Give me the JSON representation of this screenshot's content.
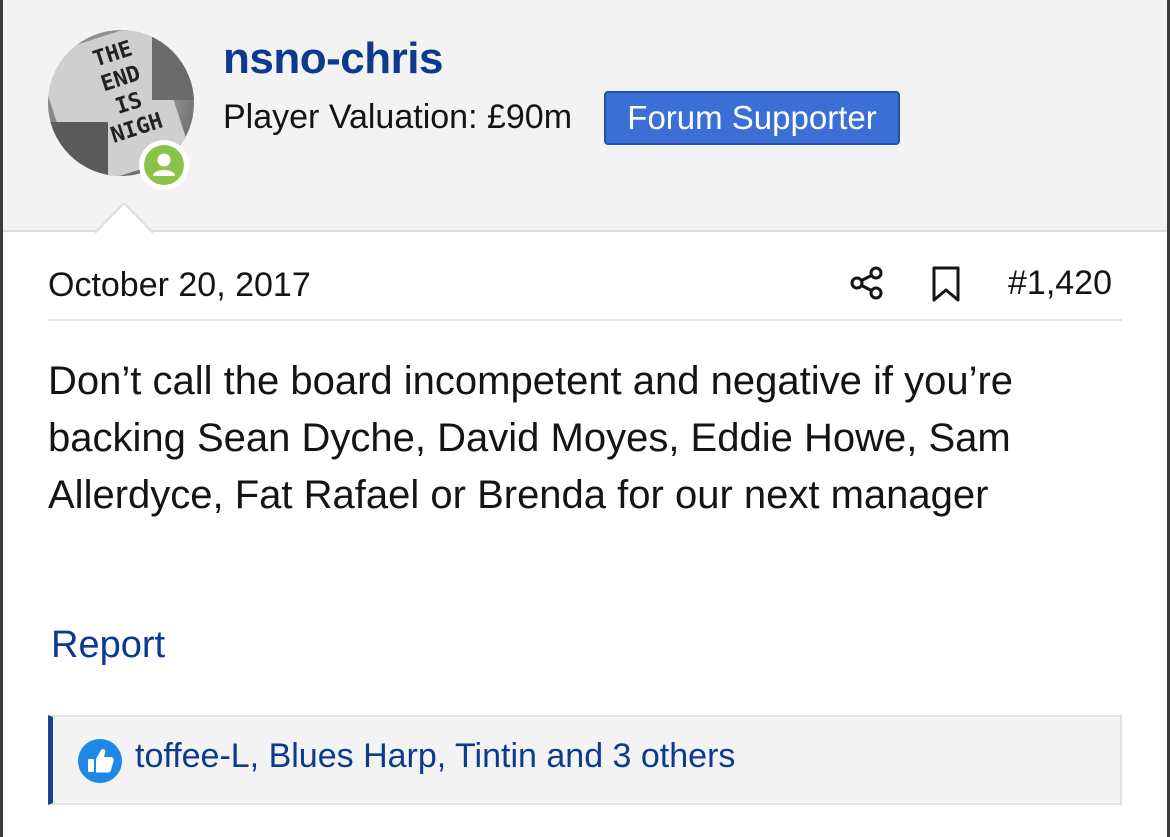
{
  "author": {
    "username": "nsno-chris",
    "valuation_text": "Player Valuation: £90m",
    "badge": "Forum Supporter",
    "avatar_sign_text": "THE END IS NIGH",
    "avatar_icon": "protest-sign-avatar",
    "status_icon": "online-user-icon",
    "status_color": "#8bc34a"
  },
  "post": {
    "date": "October 20, 2017",
    "number": "#1,420",
    "share_icon": "share-icon",
    "bookmark_icon": "bookmark-icon",
    "text": "Don’t call the board incompetent and negative if you’re backing Sean Dyche, David Moyes, Eddie Howe, Sam Allerdyce, Fat Rafael or Brenda for our next manager",
    "report_label": "Report"
  },
  "reactions": {
    "icon": "thumbs-up-icon",
    "text": "toffee-L, Blues Harp, Tintin and 3 others"
  },
  "colors": {
    "link": "#0b3a8f",
    "badge_bg": "#3b6fd6",
    "header_bg": "#f3f3f3",
    "like_icon": "#1e88e5"
  }
}
